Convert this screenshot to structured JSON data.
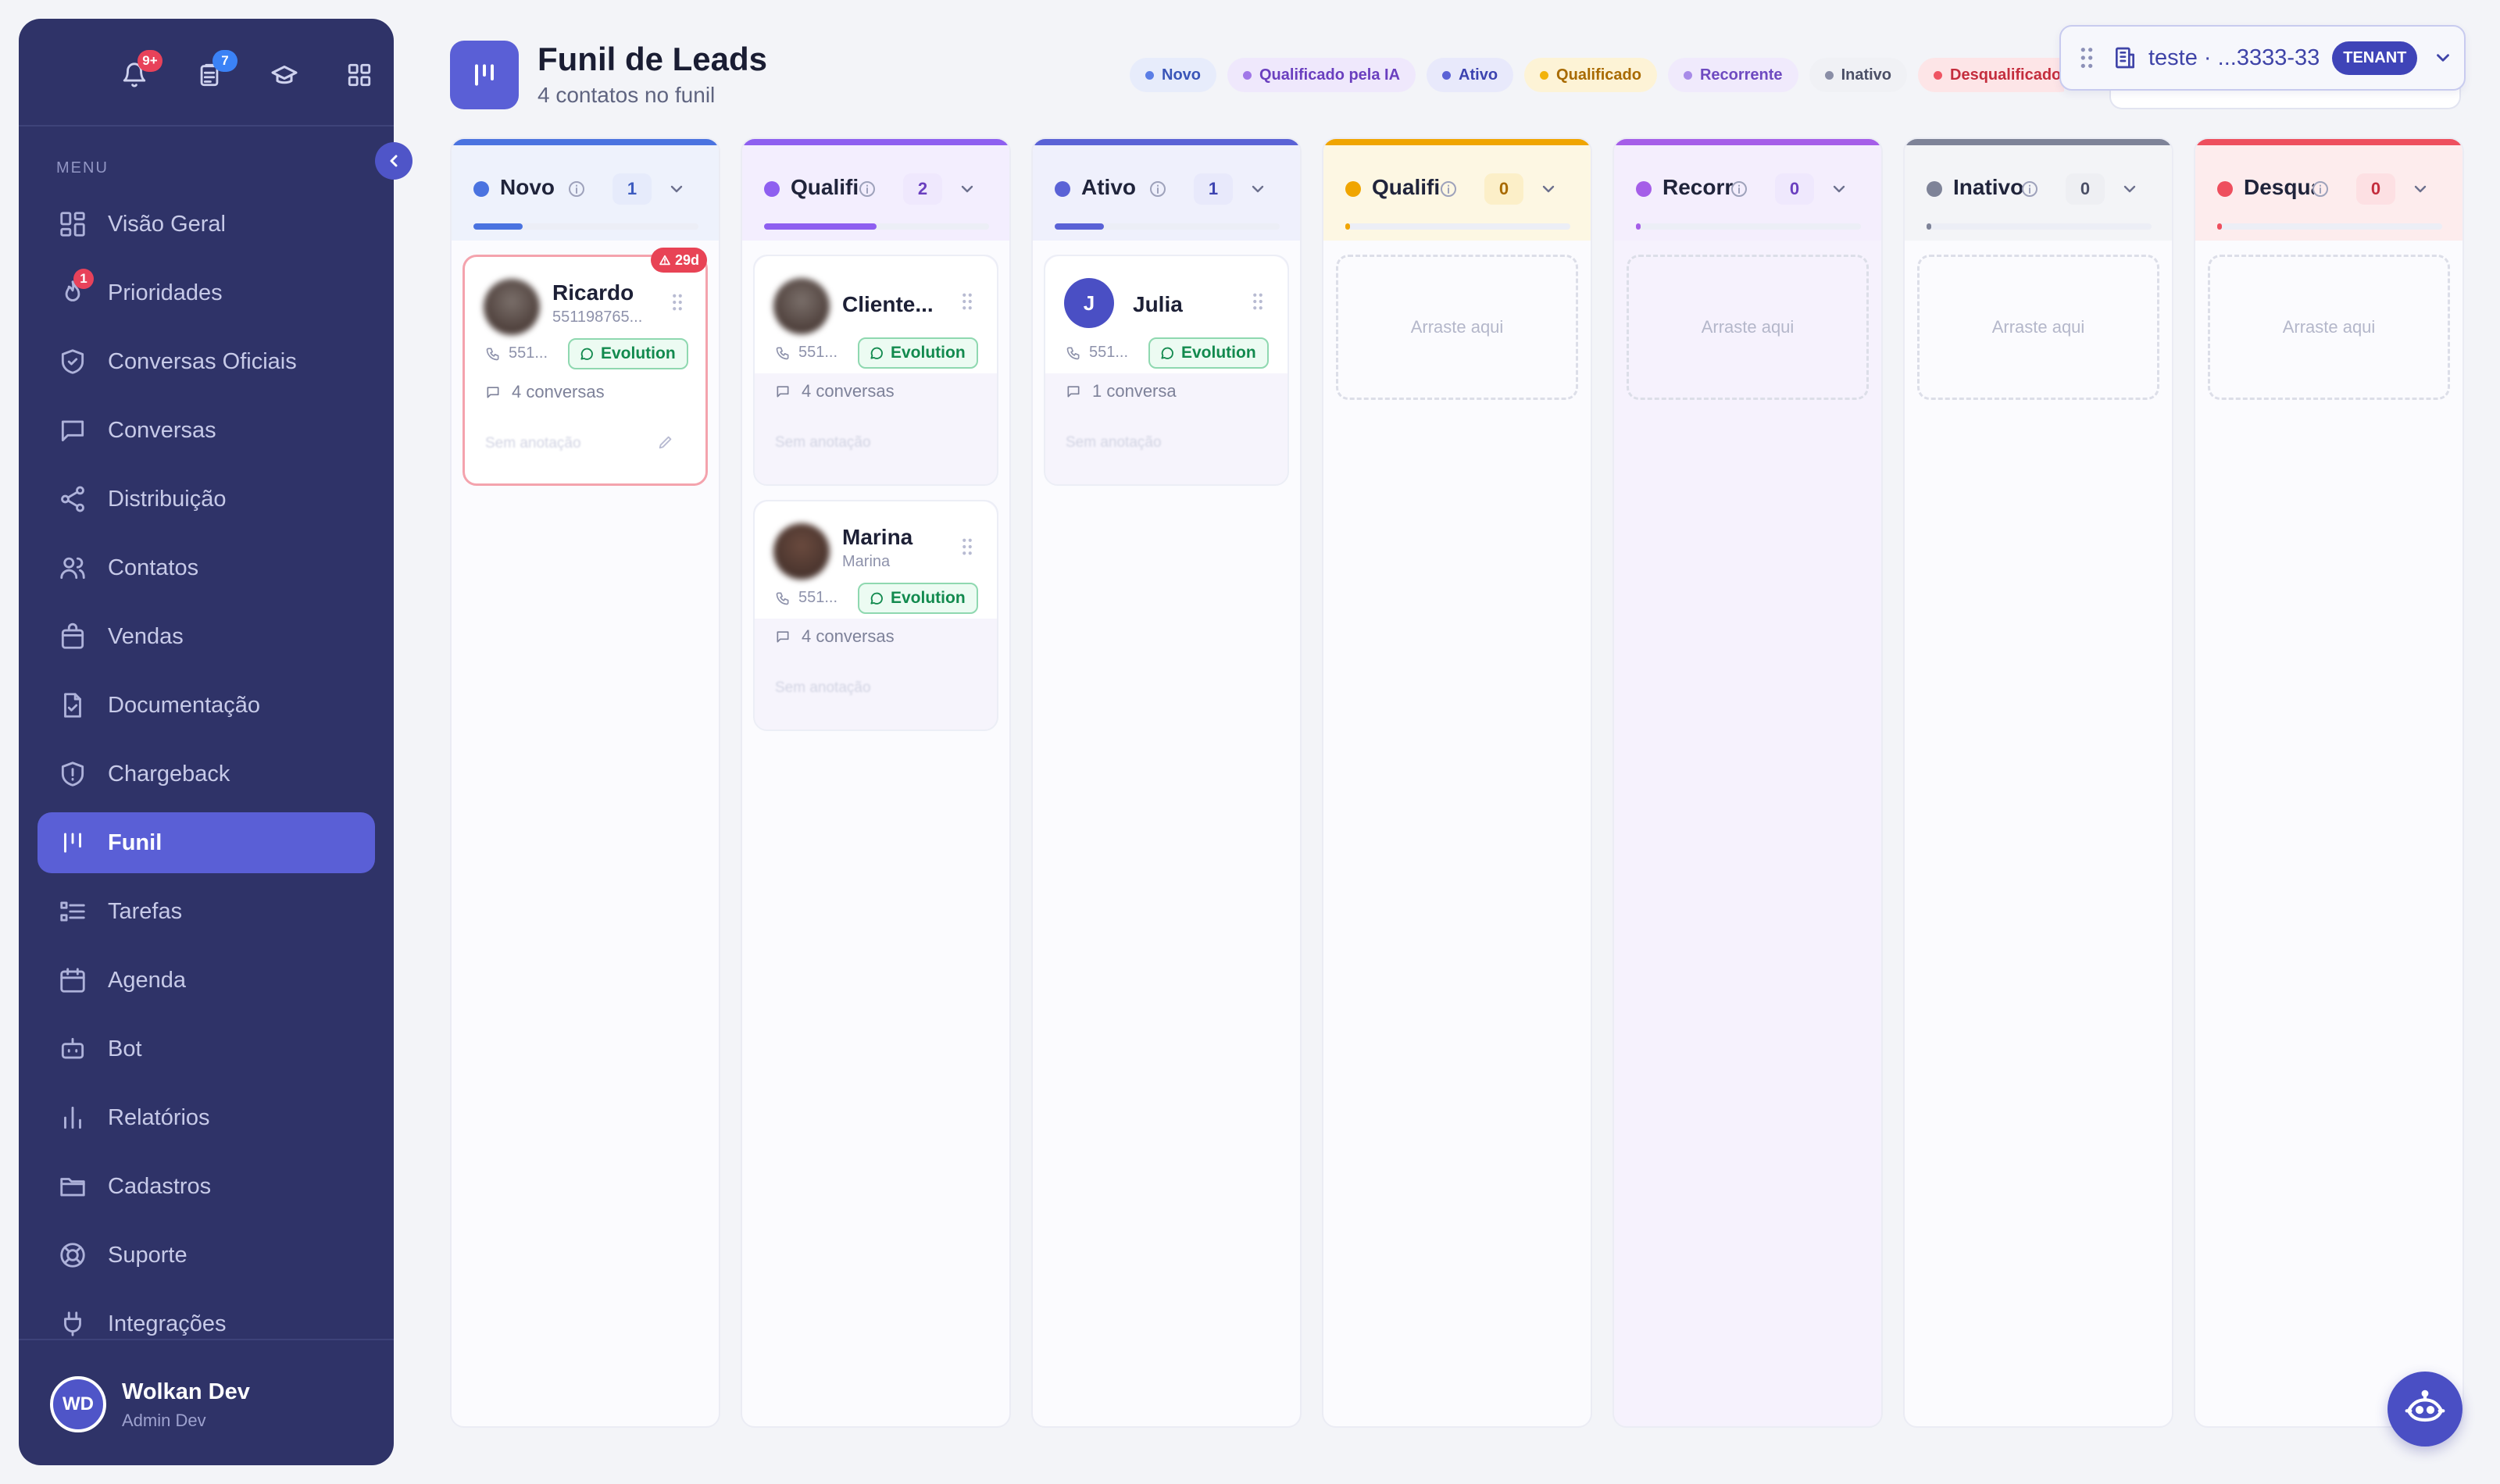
{
  "sidebar": {
    "top_badges": {
      "notifications": "9+",
      "tasks": "7"
    },
    "menu_label": "MENU",
    "items": [
      {
        "label": "Visão Geral",
        "icon": "grid-layout-icon"
      },
      {
        "label": "Prioridades",
        "icon": "flame-icon",
        "badge": "1"
      },
      {
        "label": "Conversas Oficiais",
        "icon": "shield-check-icon"
      },
      {
        "label": "Conversas",
        "icon": "chat-icon"
      },
      {
        "label": "Distribuição",
        "icon": "share-icon"
      },
      {
        "label": "Contatos",
        "icon": "users-icon"
      },
      {
        "label": "Vendas",
        "icon": "shopping-bag-icon"
      },
      {
        "label": "Documentação",
        "icon": "document-check-icon"
      },
      {
        "label": "Chargeback",
        "icon": "shield-alert-icon"
      },
      {
        "label": "Funil",
        "icon": "funnel-icon",
        "active": true
      },
      {
        "label": "Tarefas",
        "icon": "task-list-icon"
      },
      {
        "label": "Agenda",
        "icon": "calendar-icon"
      },
      {
        "label": "Bot",
        "icon": "bot-icon"
      },
      {
        "label": "Relatórios",
        "icon": "bar-chart-icon"
      },
      {
        "label": "Cadastros",
        "icon": "folder-icon"
      },
      {
        "label": "Suporte",
        "icon": "lifebuoy-icon"
      },
      {
        "label": "Integrações",
        "icon": "plug-icon"
      }
    ],
    "user": {
      "initials": "WD",
      "name": "Wolkan Dev",
      "role": "Admin Dev"
    }
  },
  "header": {
    "title": "Funil de Leads",
    "subtitle": "4 contatos no funil"
  },
  "legend": [
    {
      "label": "Novo",
      "dot": "#5b7ee6",
      "bg": "#e7ecfb",
      "fg": "#3a55b8"
    },
    {
      "label": "Qualificado pela IA",
      "dot": "#a177e8",
      "bg": "#efe8fc",
      "fg": "#6a3fbf"
    },
    {
      "label": "Ativo",
      "dot": "#5a62d6",
      "bg": "#e8e9fb",
      "fg": "#3c43b0"
    },
    {
      "label": "Qualificado",
      "dot": "#f2b30a",
      "bg": "#fdf3d6",
      "fg": "#a86a00"
    },
    {
      "label": "Recorrente",
      "dot": "#a88be8",
      "bg": "#f0eafc",
      "fg": "#6e4ac0"
    },
    {
      "label": "Inativo",
      "dot": "#8a8ea6",
      "bg": "#f0f1f5",
      "fg": "#4b4f66"
    },
    {
      "label": "Desqualificado",
      "dot": "#ef5563",
      "bg": "#fde5e7",
      "fg": "#c42d3d"
    }
  ],
  "tenant": {
    "label": "teste · ...3333-33",
    "tag": "TENANT"
  },
  "columns": [
    {
      "name": "Novo",
      "count": "1",
      "color": "#4a73e0",
      "tint": "#eef2fc",
      "countBg": "#e6ebfb",
      "countFg": "#3d5bbf",
      "progress": 0.22,
      "cards": [
        {
          "name": "Ricardo",
          "sub": "551198765...",
          "phone": "551...",
          "channel": "Evolution",
          "convs": "4 conversas",
          "note": "Sem anotação",
          "age": "29d",
          "avatar": "photo",
          "alert": true
        }
      ]
    },
    {
      "name": "Qualificado pela IA",
      "count": "2",
      "color": "#8e5ff0",
      "tint": "#f3eefe",
      "countBg": "#efe8fd",
      "countFg": "#6a3fbf",
      "progress": 0.5,
      "cards": [
        {
          "name": "Cliente...",
          "sub": "",
          "phone": "551...",
          "channel": "Evolution",
          "convs": "4 conversas",
          "note": "Sem anotação",
          "avatar": "photo"
        },
        {
          "name": "Marina",
          "sub": "Marina",
          "phone": "551...",
          "channel": "Evolution",
          "convs": "4 conversas",
          "note": "Sem anotação",
          "avatar": "photo"
        }
      ]
    },
    {
      "name": "Ativo",
      "count": "1",
      "color": "#5a62d6",
      "tint": "#eff0fc",
      "countBg": "#e8e9fb",
      "countFg": "#3c43b0",
      "progress": 0.22,
      "cards": [
        {
          "name": "Julia",
          "sub": "",
          "phone": "551...",
          "channel": "Evolution",
          "convs": "1 conversa",
          "note": "Sem anotação",
          "avatar": "J"
        }
      ]
    },
    {
      "name": "Qualificado",
      "count": "0",
      "color": "#f0a500",
      "tint": "#fdf7e3",
      "countBg": "#fcefc8",
      "countFg": "#a86a00",
      "progress": 0,
      "cards": [],
      "drop": "Arraste aqui"
    },
    {
      "name": "Recorrente",
      "count": "0",
      "color": "#a55ee8",
      "tint": "#f4eefd",
      "countBg": "#efe8fd",
      "countFg": "#6a3fbf",
      "progress": 0,
      "cards": [],
      "drop": "Arraste aqui"
    },
    {
      "name": "Inativo",
      "count": "0",
      "color": "#7e8398",
      "tint": "#f3f4f7",
      "countBg": "#eeeff3",
      "countFg": "#4b4f66",
      "progress": 0,
      "cards": [],
      "drop": "Arraste aqui"
    },
    {
      "name": "Desqualificado",
      "count": "0",
      "color": "#ee4f5e",
      "tint": "#fdeced",
      "countBg": "#fde0e3",
      "countFg": "#c42d3d",
      "progress": 0,
      "cards": [],
      "drop": "Arraste aqui"
    }
  ]
}
